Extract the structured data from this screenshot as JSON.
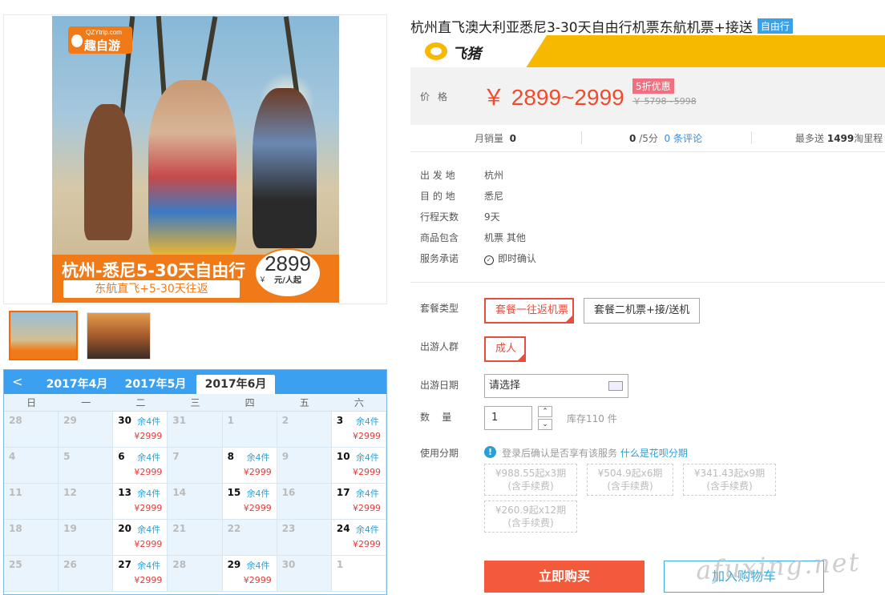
{
  "product": {
    "title": "杭州直飞澳大利亚悉尼3-30天自由行机票东航机票+接送",
    "tag": "自由行"
  },
  "poster": {
    "logo_small": "QZYtrip.com",
    "logo_big": "趣自游",
    "headline": "杭州-悉尼5-30天自由行",
    "subline": "东航直飞+5-30天往返",
    "price": "2899",
    "price_unit": "元/人起",
    "currency": "￥"
  },
  "calendar": {
    "prev": "<",
    "tabs": [
      "2017年4月",
      "2017年5月",
      "2017年6月"
    ],
    "active_tab": 2,
    "weekdays": [
      "日",
      "一",
      "二",
      "三",
      "四",
      "五",
      "六"
    ],
    "stock_text": "余4件",
    "price_text": "¥2999",
    "rows": [
      [
        {
          "d": "28"
        },
        {
          "d": "29"
        },
        {
          "d": "30",
          "av": true
        },
        {
          "d": "31"
        },
        {
          "d": "1"
        },
        {
          "d": "2"
        },
        {
          "d": "3",
          "av": true
        }
      ],
      [
        {
          "d": "4"
        },
        {
          "d": "5"
        },
        {
          "d": "6",
          "av": true
        },
        {
          "d": "7"
        },
        {
          "d": "8",
          "av": true
        },
        {
          "d": "9"
        },
        {
          "d": "10",
          "av": true
        }
      ],
      [
        {
          "d": "11"
        },
        {
          "d": "12"
        },
        {
          "d": "13",
          "av": true
        },
        {
          "d": "14"
        },
        {
          "d": "15",
          "av": true
        },
        {
          "d": "16"
        },
        {
          "d": "17",
          "av": true
        }
      ],
      [
        {
          "d": "18"
        },
        {
          "d": "19"
        },
        {
          "d": "20",
          "av": true
        },
        {
          "d": "21"
        },
        {
          "d": "22"
        },
        {
          "d": "23"
        },
        {
          "d": "24",
          "av": true
        }
      ],
      [
        {
          "d": "25"
        },
        {
          "d": "26"
        },
        {
          "d": "27",
          "av": true
        },
        {
          "d": "28"
        },
        {
          "d": "29",
          "av": true
        },
        {
          "d": "30"
        },
        {
          "d": "1",
          "white": true
        }
      ]
    ]
  },
  "shop": {
    "logo_text": "飞猪"
  },
  "price": {
    "label": "价格",
    "value": "￥ 2899~2999",
    "discount": "5折优惠",
    "original": "￥ 5798~5998"
  },
  "stats": {
    "monthly_label": "月销量",
    "monthly_value": "0",
    "rating_value": "0",
    "rating_unit": "/5分",
    "reviews": "0 条评论",
    "points_pre": "最多送",
    "points_value": "1499",
    "points_post": "淘里程"
  },
  "details": [
    {
      "label": "出 发 地",
      "value": "杭州"
    },
    {
      "label": "目 的 地",
      "value": "悉尼"
    },
    {
      "label": "行程天数",
      "value": "9天"
    },
    {
      "label": "商品包含",
      "value": "机票  其他"
    },
    {
      "label": "服务承诺",
      "value": "即时确认"
    }
  ],
  "options": {
    "package_label": "套餐类型",
    "packages": [
      "套餐一往返机票",
      "套餐二机票+接/送机"
    ],
    "crowd_label": "出游人群",
    "crowd": "成人",
    "date_label": "出游日期",
    "date_placeholder": "请选择",
    "qty_label": "数    量",
    "qty_value": "1",
    "stock": "库存110 件",
    "installment_label": "使用分期",
    "huabei_text": "登录后确认是否享有该服务",
    "huabei_link": "什么是花呗分期",
    "installments": [
      {
        "a": "¥988.55起x3期",
        "b": "(含手续费)"
      },
      {
        "a": "¥504.9起x6期",
        "b": "(含手续费)"
      },
      {
        "a": "¥341.43起x9期",
        "b": "(含手续费)"
      },
      {
        "a": "¥260.9起x12期",
        "b": "(含手续费)"
      }
    ]
  },
  "actions": {
    "buy": "立即购买",
    "cart": "加入购物车"
  },
  "watermark": "afuxing.net",
  "colors": {
    "accent": "#f35a3c",
    "calendar": "#3ba0f0",
    "banner": "#f7b800"
  }
}
